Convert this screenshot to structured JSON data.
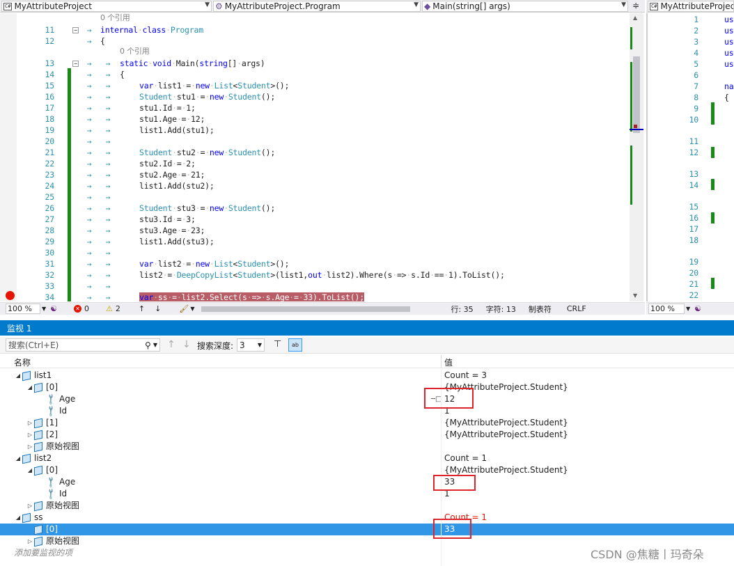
{
  "navbar": {
    "project_combo": "MyAttributeProject",
    "class_combo": "MyAttributeProject.Program",
    "member_combo": "Main(string[] args)",
    "right_combo": "MyAttributeProjec"
  },
  "editor": {
    "ref_label": "0 个引用",
    "lines": [
      {
        "n": "11",
        "text": "internal class Program"
      },
      {
        "n": "12",
        "text": "{"
      },
      {
        "n": "13",
        "text": "static void Main(string[] args)"
      },
      {
        "n": "14",
        "text": "{"
      },
      {
        "n": "15",
        "text": "var list1 = new List<Student>();"
      },
      {
        "n": "16",
        "text": "Student stu1 = new Student();"
      },
      {
        "n": "17",
        "text": "stu1.Id = 1;"
      },
      {
        "n": "18",
        "text": "stu1.Age = 12;"
      },
      {
        "n": "19",
        "text": "list1.Add(stu1);"
      },
      {
        "n": "20",
        "text": ""
      },
      {
        "n": "21",
        "text": "Student stu2 = new Student();"
      },
      {
        "n": "22",
        "text": "stu2.Id = 2;"
      },
      {
        "n": "23",
        "text": "stu2.Age = 21;"
      },
      {
        "n": "24",
        "text": "list1.Add(stu2);"
      },
      {
        "n": "25",
        "text": ""
      },
      {
        "n": "26",
        "text": "Student stu3 = new Student();"
      },
      {
        "n": "27",
        "text": "stu3.Id = 3;"
      },
      {
        "n": "28",
        "text": "stu3.Age = 23;"
      },
      {
        "n": "29",
        "text": "list1.Add(stu3);"
      },
      {
        "n": "30",
        "text": ""
      },
      {
        "n": "31",
        "text": "var list2 = new List<Student>();"
      },
      {
        "n": "32",
        "text": "list2 = DeepCopyList<Student>(list1,out list2).Where(s => s.Id == 1).ToList();"
      },
      {
        "n": "33",
        "text": ""
      },
      {
        "n": "34",
        "text": "var ss = list2.Select(s => s.Age = 33).ToList();"
      }
    ],
    "right_lines": [
      "1",
      "2",
      "3",
      "4",
      "5",
      "6",
      "7",
      "8",
      "9",
      "10",
      "11",
      "12",
      "13",
      "14",
      "15",
      "16",
      "17",
      "18",
      "19",
      "20",
      "21",
      "22"
    ],
    "right_code": [
      "us",
      "us",
      "us",
      "us",
      "us",
      "",
      "nam",
      "{"
    ]
  },
  "status": {
    "zoom": "100 %",
    "errors": "0",
    "warnings": "2",
    "line": "行: 35",
    "col": "字符: 13",
    "tab": "制表符",
    "eol": "CRLF",
    "right_zoom": "100 %"
  },
  "watch": {
    "title": "监视 1",
    "search_placeholder": "搜索(Ctrl+E)",
    "depth_label": "搜索深度:",
    "depth_value": "3",
    "col_name": "名称",
    "col_value": "值",
    "rows": [
      {
        "name": "list1",
        "value": "Count = 3"
      },
      {
        "name": "[0]",
        "value": "{MyAttributeProject.Student}"
      },
      {
        "name": "Age",
        "value": "12"
      },
      {
        "name": "Id",
        "value": "1"
      },
      {
        "name": "[1]",
        "value": "{MyAttributeProject.Student}"
      },
      {
        "name": "[2]",
        "value": "{MyAttributeProject.Student}"
      },
      {
        "name": "原始视图",
        "value": ""
      },
      {
        "name": "list2",
        "value": "Count = 1"
      },
      {
        "name": "[0]",
        "value": "{MyAttributeProject.Student}"
      },
      {
        "name": "Age",
        "value": "33"
      },
      {
        "name": "Id",
        "value": "1"
      },
      {
        "name": "原始视图",
        "value": ""
      },
      {
        "name": "ss",
        "value": "Count = 1"
      },
      {
        "name": "[0]",
        "value": "33"
      },
      {
        "name": "原始视图",
        "value": ""
      }
    ],
    "add_item": "添加要监视的项"
  },
  "watermark": "CSDN @焦糖丨玛奇朵",
  "colors": {
    "accent": "#007acc",
    "selection": "#3296e6",
    "annotation": "#e0242c",
    "changed_value": "#e51400"
  }
}
